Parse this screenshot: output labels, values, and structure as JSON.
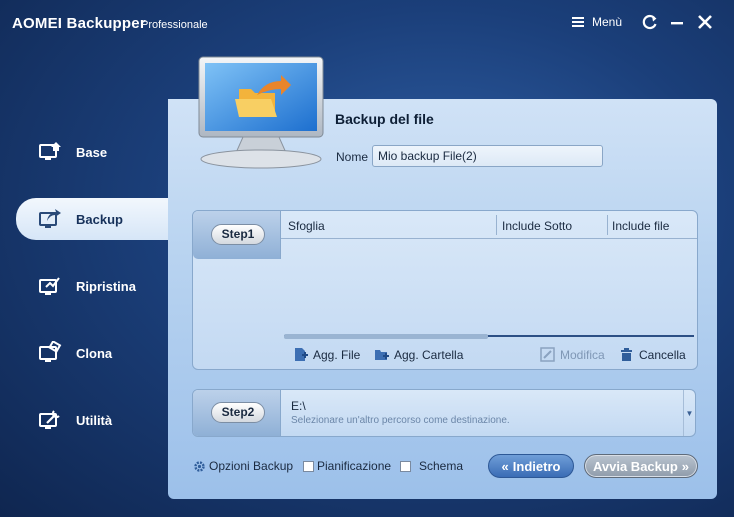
{
  "app": {
    "title": "AOMEI Backupper",
    "edition": "Professionale",
    "menu_label": "Menù"
  },
  "sidebar": {
    "items": [
      {
        "label": "Base",
        "icon": "monitor-home-icon",
        "active": false
      },
      {
        "label": "Backup",
        "icon": "monitor-backup-icon",
        "active": true
      },
      {
        "label": "Ripristina",
        "icon": "monitor-restore-icon",
        "active": false
      },
      {
        "label": "Clona",
        "icon": "monitor-clone-icon",
        "active": false
      },
      {
        "label": "Utilità",
        "icon": "monitor-tools-icon",
        "active": false
      }
    ]
  },
  "main": {
    "title": "Backup del file",
    "name_label": "Nome",
    "name_value": "Mio backup File(2)",
    "step1": {
      "label": "Step1",
      "columns": [
        "Sfoglia",
        "Include Sotto",
        "Include file"
      ],
      "actions": {
        "add_file": "Agg. File",
        "add_folder": "Agg. Cartella",
        "edit": "Modifica",
        "delete": "Cancella"
      }
    },
    "step2": {
      "label": "Step2",
      "path": "E:\\",
      "hint": "Selezionare un'altro percorso come destinazione."
    },
    "options": {
      "backup_options": "Opzioni Backup",
      "schedule": "Pianificazione",
      "scheme": "Schema"
    },
    "buttons": {
      "back": "Indietro",
      "start": "Avvia Backup"
    }
  },
  "colors": {
    "background": "#1b3f7a",
    "panel": "#b8d3f0",
    "back_button": "#3a6cb5"
  }
}
